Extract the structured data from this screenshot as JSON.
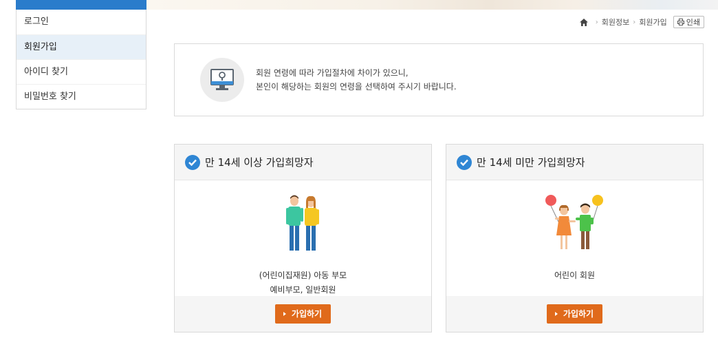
{
  "sidebar": {
    "items": [
      {
        "label": "로그인"
      },
      {
        "label": "회원가입"
      },
      {
        "label": "아이디 찾기"
      },
      {
        "label": "비밀번호 찾기"
      }
    ]
  },
  "breadcrumb": {
    "items": [
      "회원정보",
      "회원가입"
    ],
    "print_label": "인쇄"
  },
  "notice": {
    "line1": "회원 연령에 따라 가입절차에 차이가 있으니,",
    "line2": "본인이 해당하는 회원의 연령을 선택하여 주시기 바랍니다."
  },
  "cards": [
    {
      "title": "만 14세 이상 가입희망자",
      "desc_line1": "(어린이집재원) 아동 부모",
      "desc_line2": "예비부모, 일반회원",
      "button_label": "가입하기"
    },
    {
      "title": "만 14세 미만 가입희망자",
      "desc_line1": "어린이 회원",
      "desc_line2": "",
      "button_label": "가입하기"
    }
  ],
  "colors": {
    "accent_blue": "#2a7ccb",
    "check_blue": "#2f86d4",
    "button_orange": "#e06a1b",
    "active_bg": "#e7f0f8"
  }
}
